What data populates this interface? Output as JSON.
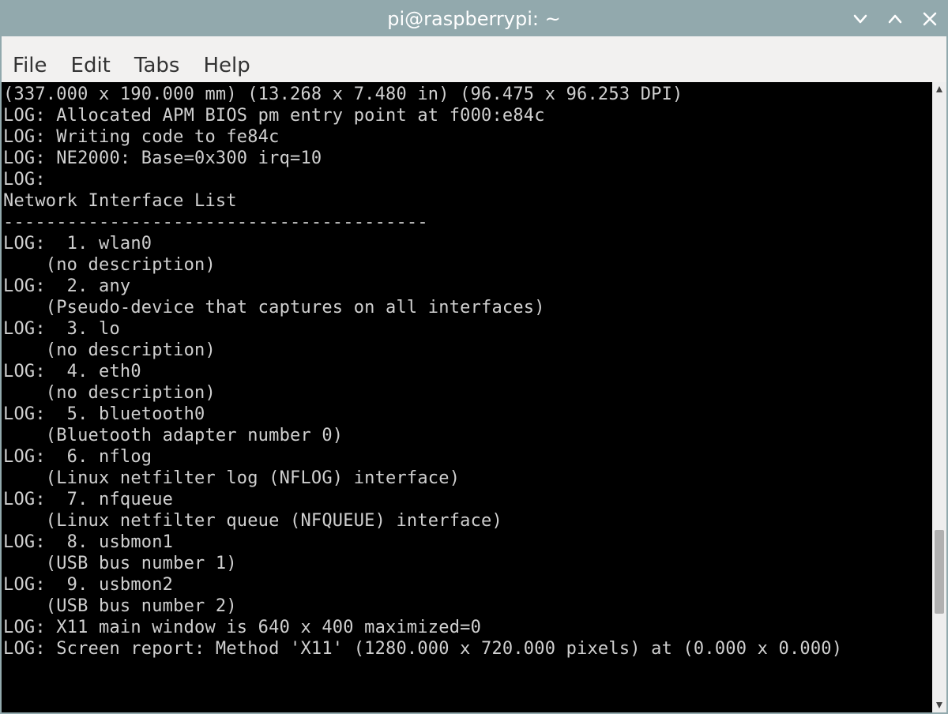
{
  "titlebar": {
    "title": "pi@raspberrypi: ~"
  },
  "menubar": {
    "items": [
      {
        "label": "File"
      },
      {
        "label": "Edit"
      },
      {
        "label": "Tabs"
      },
      {
        "label": "Help"
      }
    ]
  },
  "terminal": {
    "lines": [
      "(337.000 x 190.000 mm) (13.268 x 7.480 in) (96.475 x 96.253 DPI)",
      "LOG: Allocated APM BIOS pm entry point at f000:e84c",
      "LOG: Writing code to fe84c",
      "LOG: NE2000: Base=0x300 irq=10",
      "LOG:",
      "Network Interface List",
      "----------------------------------------",
      "LOG:  1. wlan0",
      "    (no description)",
      "LOG:  2. any",
      "    (Pseudo-device that captures on all interfaces)",
      "LOG:  3. lo",
      "    (no description)",
      "LOG:  4. eth0",
      "    (no description)",
      "LOG:  5. bluetooth0",
      "    (Bluetooth adapter number 0)",
      "LOG:  6. nflog",
      "    (Linux netfilter log (NFLOG) interface)",
      "LOG:  7. nfqueue",
      "    (Linux netfilter queue (NFQUEUE) interface)",
      "LOG:  8. usbmon1",
      "    (USB bus number 1)",
      "LOG:  9. usbmon2",
      "    (USB bus number 2)",
      "LOG: X11 main window is 640 x 400 maximized=0",
      "LOG: Screen report: Method 'X11' (1280.000 x 720.000 pixels) at (0.000 x 0.000)"
    ]
  }
}
